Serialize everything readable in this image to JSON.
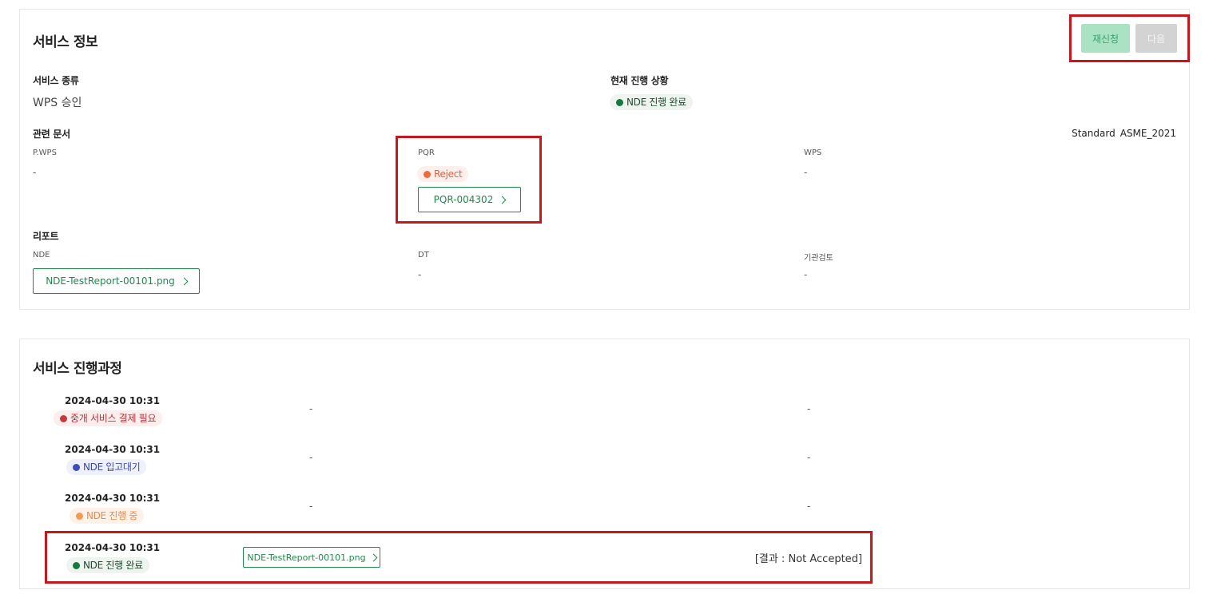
{
  "service_info": {
    "title": "서비스 정보",
    "buttons": {
      "reapply": "재신청",
      "next": "다음"
    },
    "service_type": {
      "label": "서비스 종류",
      "value": "WPS 승인"
    },
    "current_status": {
      "label": "현재 진행 상황",
      "badge": "NDE 진행 완료"
    },
    "documents": {
      "label": "관련 문서",
      "standard_label": "Standard",
      "standard_value": "ASME_2021",
      "pwps": {
        "label": "P.WPS",
        "value": "-"
      },
      "pqr": {
        "label": "PQR",
        "badge": "Reject",
        "link": "PQR-004302"
      },
      "wps": {
        "label": "WPS",
        "value": "-"
      }
    },
    "reports": {
      "label": "리포트",
      "nde": {
        "label": "NDE",
        "link": "NDE-TestReport-00101.png"
      },
      "dt": {
        "label": "DT",
        "value": "-"
      },
      "review": {
        "label": "기관검토",
        "value": "-"
      }
    }
  },
  "progress": {
    "title": "서비스 진행과정",
    "steps": [
      {
        "time": "2024-04-30 10:31",
        "status": "중개 서비스 결제 필요",
        "col2": "-",
        "col3": "-"
      },
      {
        "time": "2024-04-30 10:31",
        "status": "NDE 입고대기",
        "col2": "-",
        "col3": "-"
      },
      {
        "time": "2024-04-30 10:31",
        "status": "NDE 진행 중",
        "col2": "-",
        "col3": "-"
      },
      {
        "time": "2024-04-30 10:31",
        "status": "NDE 진행 완료",
        "file": "NDE-TestReport-00101.png",
        "result": "[결과 : Not Accepted]"
      }
    ]
  },
  "colors": {
    "accent_green": "#1f8a4c",
    "highlight_red": "#c8161d",
    "reapply_bg": "#a9e3c4",
    "next_bg": "#d3d3d3"
  }
}
